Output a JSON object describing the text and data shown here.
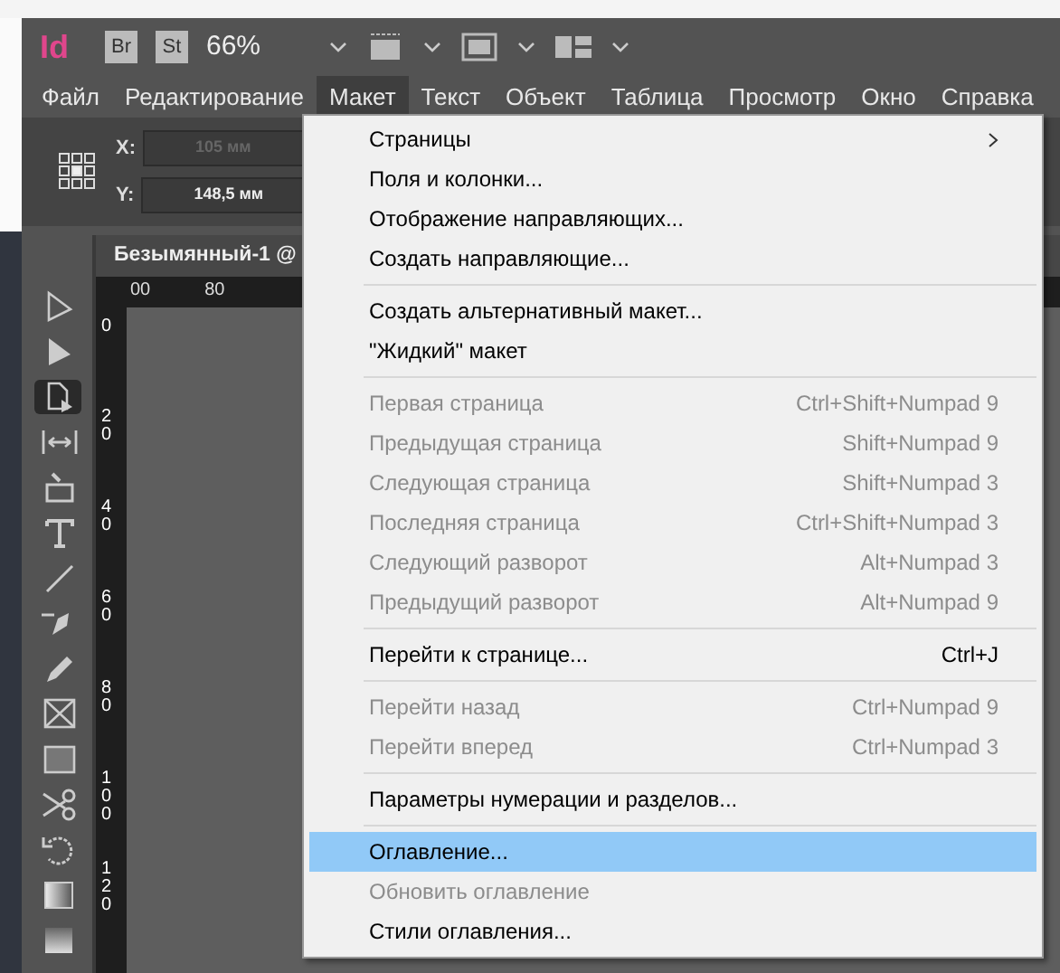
{
  "app_bar": {
    "logo": "Id",
    "bridge": "Br",
    "stock": "St",
    "zoom": "66%"
  },
  "menubar": [
    {
      "label": "Файл",
      "selected": false
    },
    {
      "label": "Редактирование",
      "selected": false
    },
    {
      "label": "Макет",
      "selected": true
    },
    {
      "label": "Текст",
      "selected": false
    },
    {
      "label": "Объект",
      "selected": false
    },
    {
      "label": "Таблица",
      "selected": false
    },
    {
      "label": "Просмотр",
      "selected": false
    },
    {
      "label": "Окно",
      "selected": false
    },
    {
      "label": "Справка",
      "selected": false
    }
  ],
  "control_panel": {
    "x_label": "X:",
    "x_value": "105 мм",
    "x_disabled": true,
    "y_label": "Y:",
    "y_value": "148,5 мм",
    "y_disabled": false
  },
  "document_tab": {
    "title": "Безымянный-1 @"
  },
  "ruler": {
    "h_ticks": [
      "00",
      "80"
    ],
    "v_ticks": [
      "0",
      "20",
      "40",
      "60",
      "80",
      "100",
      "120"
    ]
  },
  "tools": [
    {
      "selected": false
    },
    {
      "selected": false
    },
    {
      "selected": true
    },
    {
      "selected": false
    },
    {
      "selected": false
    },
    {
      "selected": false
    },
    {
      "selected": false
    },
    {
      "selected": false
    },
    {
      "selected": false
    },
    {
      "selected": false
    },
    {
      "selected": false
    },
    {
      "selected": false
    },
    {
      "selected": false
    },
    {
      "selected": false
    },
    {
      "selected": false
    }
  ],
  "menu": [
    {
      "kind": "item",
      "label": "Страницы",
      "submenu": true,
      "disabled": false,
      "selected": false
    },
    {
      "kind": "item",
      "label": "Поля и колонки...",
      "disabled": false,
      "selected": false
    },
    {
      "kind": "item",
      "label": "Отображение направляющих...",
      "disabled": false,
      "selected": false
    },
    {
      "kind": "item",
      "label": "Создать направляющие...",
      "disabled": false,
      "selected": false
    },
    {
      "kind": "separator"
    },
    {
      "kind": "item",
      "label": "Создать альтернативный макет...",
      "disabled": false,
      "selected": false
    },
    {
      "kind": "item",
      "label": "\"Жидкий\" макет",
      "disabled": false,
      "selected": false
    },
    {
      "kind": "separator"
    },
    {
      "kind": "item",
      "label": "Первая страница",
      "shortcut": "Ctrl+Shift+Numpad 9",
      "disabled": true,
      "selected": false
    },
    {
      "kind": "item",
      "label": "Предыдущая страница",
      "shortcut": "Shift+Numpad 9",
      "disabled": true,
      "selected": false
    },
    {
      "kind": "item",
      "label": "Следующая страница",
      "shortcut": "Shift+Numpad 3",
      "disabled": true,
      "selected": false
    },
    {
      "kind": "item",
      "label": "Последняя страница",
      "shortcut": "Ctrl+Shift+Numpad 3",
      "disabled": true,
      "selected": false
    },
    {
      "kind": "item",
      "label": "Следующий разворот",
      "shortcut": "Alt+Numpad 3",
      "disabled": true,
      "selected": false
    },
    {
      "kind": "item",
      "label": "Предыдущий разворот",
      "shortcut": "Alt+Numpad 9",
      "disabled": true,
      "selected": false
    },
    {
      "kind": "separator"
    },
    {
      "kind": "item",
      "label": "Перейти к странице...",
      "shortcut": "Ctrl+J",
      "disabled": false,
      "selected": false
    },
    {
      "kind": "separator"
    },
    {
      "kind": "item",
      "label": "Перейти назад",
      "shortcut": "Ctrl+Numpad 9",
      "disabled": true,
      "selected": false
    },
    {
      "kind": "item",
      "label": "Перейти вперед",
      "shortcut": "Ctrl+Numpad 3",
      "disabled": true,
      "selected": false
    },
    {
      "kind": "separator"
    },
    {
      "kind": "item",
      "label": "Параметры нумерации и разделов...",
      "disabled": false,
      "selected": false
    },
    {
      "kind": "separator"
    },
    {
      "kind": "item",
      "label": "Оглавление...",
      "disabled": false,
      "selected": true
    },
    {
      "kind": "item",
      "label": "Обновить оглавление",
      "disabled": true,
      "selected": false
    },
    {
      "kind": "item",
      "label": "Стили оглавления...",
      "disabled": false,
      "selected": false
    }
  ]
}
